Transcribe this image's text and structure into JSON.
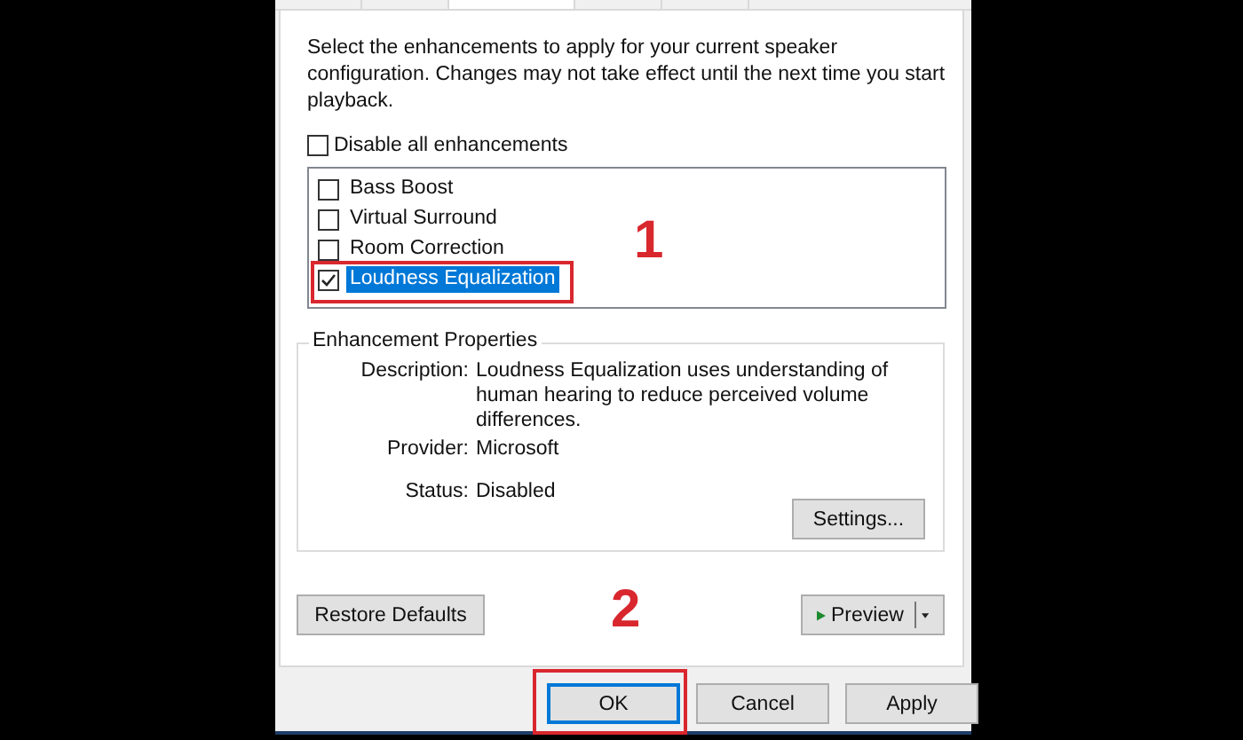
{
  "intro": "Select the enhancements to apply for your current speaker configuration. Changes may not take effect until the next time you start playback.",
  "disable_all": {
    "label": "Disable all enhancements",
    "checked": false
  },
  "enhancements": [
    {
      "label": "Bass Boost",
      "checked": false,
      "selected": false
    },
    {
      "label": "Virtual Surround",
      "checked": false,
      "selected": false
    },
    {
      "label": "Room Correction",
      "checked": false,
      "selected": false
    },
    {
      "label": "Loudness Equalization",
      "checked": true,
      "selected": true
    }
  ],
  "properties": {
    "title": "Enhancement Properties",
    "rows": [
      {
        "label": "Description:",
        "value": "Loudness Equalization uses understanding of human hearing to reduce perceived volume differences."
      },
      {
        "label": "Provider:",
        "value": "Microsoft"
      },
      {
        "label": "Status:",
        "value": "Disabled"
      }
    ],
    "settings_button": "Settings..."
  },
  "restore_button": "Restore Defaults",
  "preview_button": "Preview",
  "footer_buttons": [
    {
      "label": "OK",
      "focused": true
    },
    {
      "label": "Cancel",
      "focused": false
    },
    {
      "label": "Apply",
      "focused": false
    }
  ],
  "annotations": [
    {
      "kind": "selected-item",
      "number": "1"
    },
    {
      "kind": "focused-button",
      "number": "2"
    }
  ]
}
